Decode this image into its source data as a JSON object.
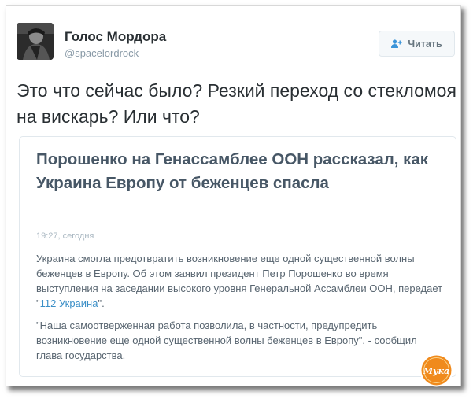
{
  "author": {
    "name": "Голос Мордора",
    "handle": "@spacelordrock"
  },
  "follow_button": {
    "label": "Читать",
    "icon": "add-user-icon"
  },
  "tweet": {
    "text": "Это что сейчас было? Резкий переход со стекломоя на вискарь? Или что?"
  },
  "card": {
    "title": "Порошенко на Генассамблее ООН рассказал, как Украина Европу от беженцев спасла",
    "timestamp": "19:27, сегодня",
    "p1_before": "Украина смогла предотвратить возникновение еще одной существенной волны беженцев в Европу. Об этом заявил президент Петр Порошенко во время выступления на заседании высокого уровня Генеральной Ассамблеи ООН, передает \"",
    "p1_link": "112 Украина",
    "p1_after": "\".",
    "p2": "\"Наша самоотверженная работа позволила, в частности, предупредить возникновение еще одной существенной волны беженцев в Европу\", - сообщил глава государства."
  },
  "watermark": {
    "text": "Мука",
    "color": "#f08a1c"
  }
}
